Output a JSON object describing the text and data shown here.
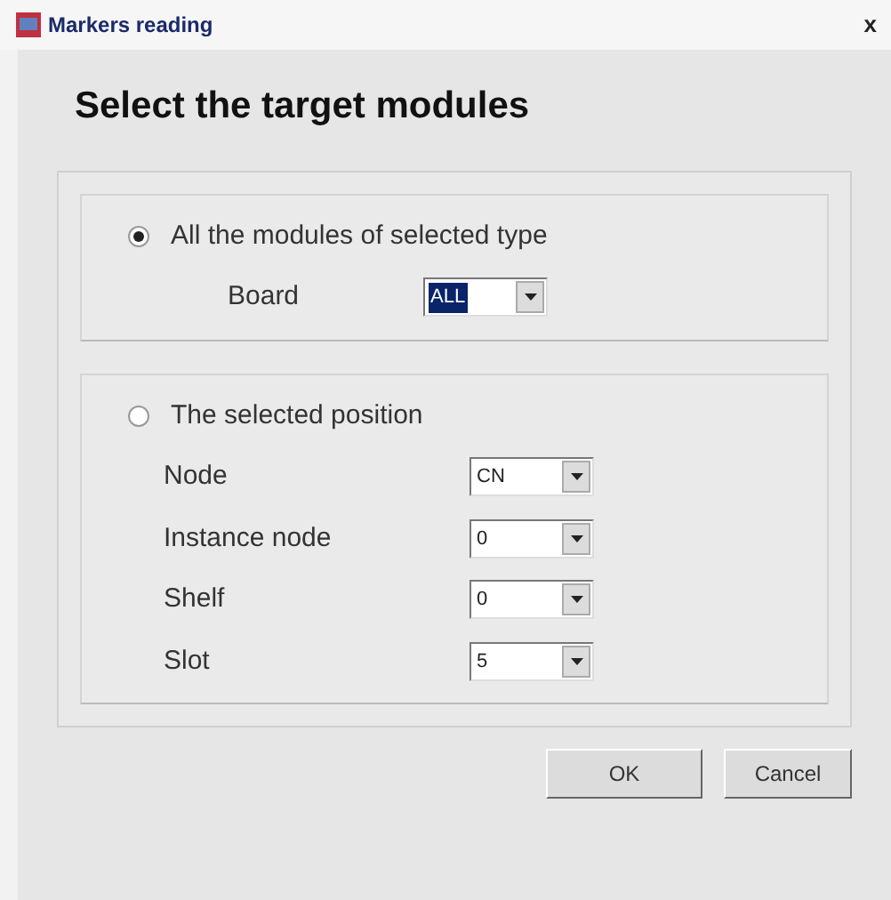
{
  "window": {
    "title": "Markers reading",
    "close": "x"
  },
  "heading": "Select the target modules",
  "options": [
    {
      "label": "All the modules of selected type",
      "selected": true,
      "fields": [
        {
          "label": "Board",
          "value": "ALL",
          "highlighted": true
        }
      ]
    },
    {
      "label": "The selected position",
      "selected": false,
      "fields": [
        {
          "label": "Node",
          "value": "CN",
          "highlighted": false
        },
        {
          "label": "Instance node",
          "value": "0",
          "highlighted": false
        },
        {
          "label": "Shelf",
          "value": "0",
          "highlighted": false
        },
        {
          "label": "Slot",
          "value": "5",
          "highlighted": false
        }
      ]
    }
  ],
  "buttons": [
    "OK",
    "Cancel"
  ]
}
